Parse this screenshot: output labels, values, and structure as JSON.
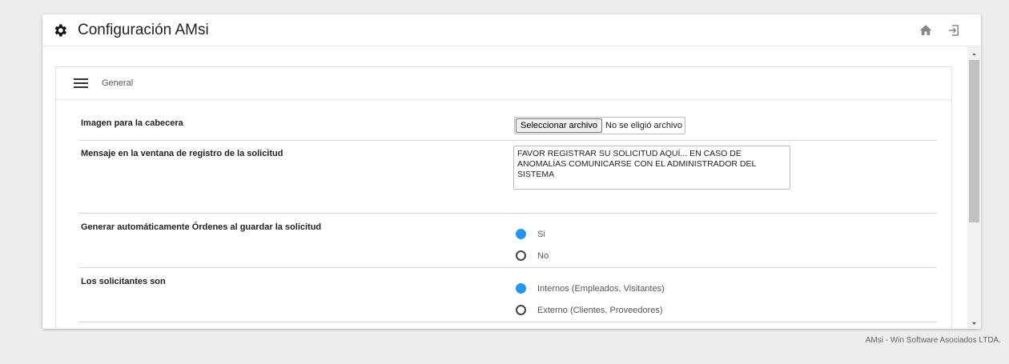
{
  "header": {
    "title": "Configuración AMsi",
    "icons": [
      "gear-icon",
      "home-icon",
      "exit-icon"
    ]
  },
  "section": {
    "title": "General",
    "icon": "menu-icon"
  },
  "settings": {
    "header_image": {
      "label": "Imagen para la cabecera",
      "button": "Seleccionar archivo",
      "status": "No se eligió archivo"
    },
    "message": {
      "label": "Mensaje en la ventana de registro de la solicitud",
      "value": "FAVOR REGISTRAR SU SOLICITUD AQUÍ... EN CASO DE ANOMALÍAS COMUNICARSE CON EL ADMINISTRADOR DEL SISTEMA"
    },
    "auto_orders": {
      "label": "Generar automáticamente Órdenes al guardar la solicitud",
      "options": [
        {
          "label": "Si",
          "selected": true
        },
        {
          "label": "No",
          "selected": false
        }
      ]
    },
    "requesters": {
      "label": "Los solicitantes son",
      "options": [
        {
          "label": "Internos (Empleados, Visitantes)",
          "selected": true
        },
        {
          "label": "Externo (Clientes, Proveedores)",
          "selected": false
        }
      ]
    }
  },
  "footer": "AMsi - Win Software Asociados LTDA.",
  "colors": {
    "accent": "#2196f3",
    "background": "#ececec"
  }
}
